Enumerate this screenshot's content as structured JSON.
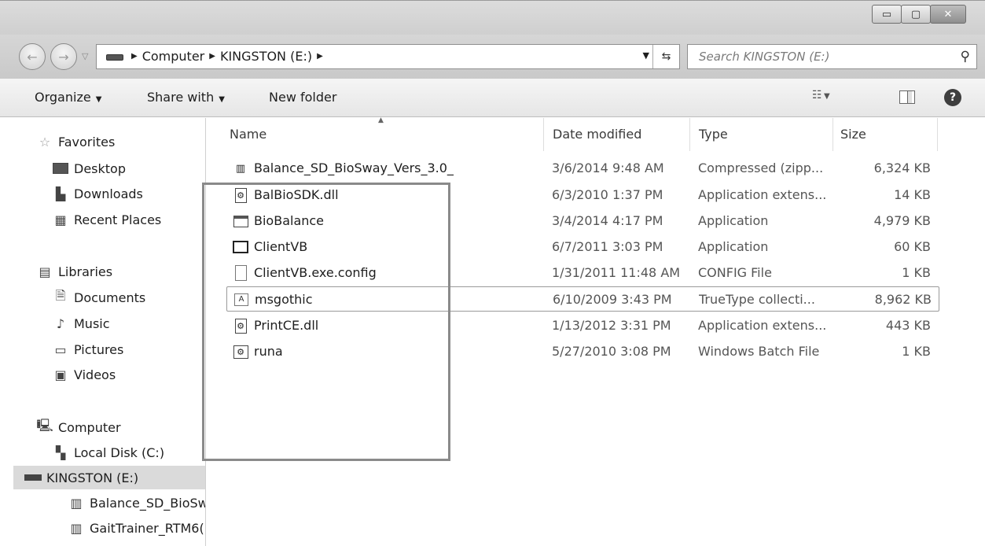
{
  "window": {
    "controls": {
      "minimize": "▭",
      "maximize": "▢",
      "close": "✕"
    }
  },
  "address": {
    "crumbs": [
      "Computer",
      "KINGSTON (E:)"
    ],
    "search_placeholder": "Search KINGSTON (E:)"
  },
  "toolbar": {
    "organize": "Organize",
    "share_with": "Share with",
    "new_folder": "New folder"
  },
  "nav": {
    "favorites": "Favorites",
    "desktop": "Desktop",
    "downloads": "Downloads",
    "recent_places": "Recent Places",
    "libraries": "Libraries",
    "documents": "Documents",
    "music": "Music",
    "pictures": "Pictures",
    "videos": "Videos",
    "computer": "Computer",
    "local_disk": "Local Disk (C:)",
    "kingston": "KINGSTON (E:)",
    "sub1": "Balance_SD_BioSw",
    "sub2": "GaitTrainer_RTM6("
  },
  "columns": {
    "name": "Name",
    "date": "Date modified",
    "type": "Type",
    "size": "Size"
  },
  "files": [
    {
      "name": "Balance_SD_BioSway_Vers_3.0_",
      "date": "3/6/2014 9:48 AM",
      "type": "Compressed (zipp...",
      "size": "6,324 KB",
      "icon": "zip-folder-icon"
    },
    {
      "name": "BalBioSDK.dll",
      "date": "6/3/2010 1:37 PM",
      "type": "Application extens...",
      "size": "14 KB",
      "icon": "dll-icon"
    },
    {
      "name": "BioBalance",
      "date": "3/4/2014 4:17 PM",
      "type": "Application",
      "size": "4,979 KB",
      "icon": "application-icon"
    },
    {
      "name": "ClientVB",
      "date": "6/7/2011 3:03 PM",
      "type": "Application",
      "size": "60 KB",
      "icon": "application-icon"
    },
    {
      "name": "ClientVB.exe.config",
      "date": "1/31/2011 11:48 AM",
      "type": "CONFIG File",
      "size": "1 KB",
      "icon": "file-icon"
    },
    {
      "name": "msgothic",
      "date": "6/10/2009 3:43 PM",
      "type": "TrueType collecti...",
      "size": "8,962 KB",
      "icon": "font-icon"
    },
    {
      "name": "PrintCE.dll",
      "date": "1/13/2012 3:31 PM",
      "type": "Application extens...",
      "size": "443 KB",
      "icon": "dll-icon"
    },
    {
      "name": "runa",
      "date": "5/27/2010 3:08 PM",
      "type": "Windows Batch File",
      "size": "1 KB",
      "icon": "batch-file-icon"
    }
  ]
}
